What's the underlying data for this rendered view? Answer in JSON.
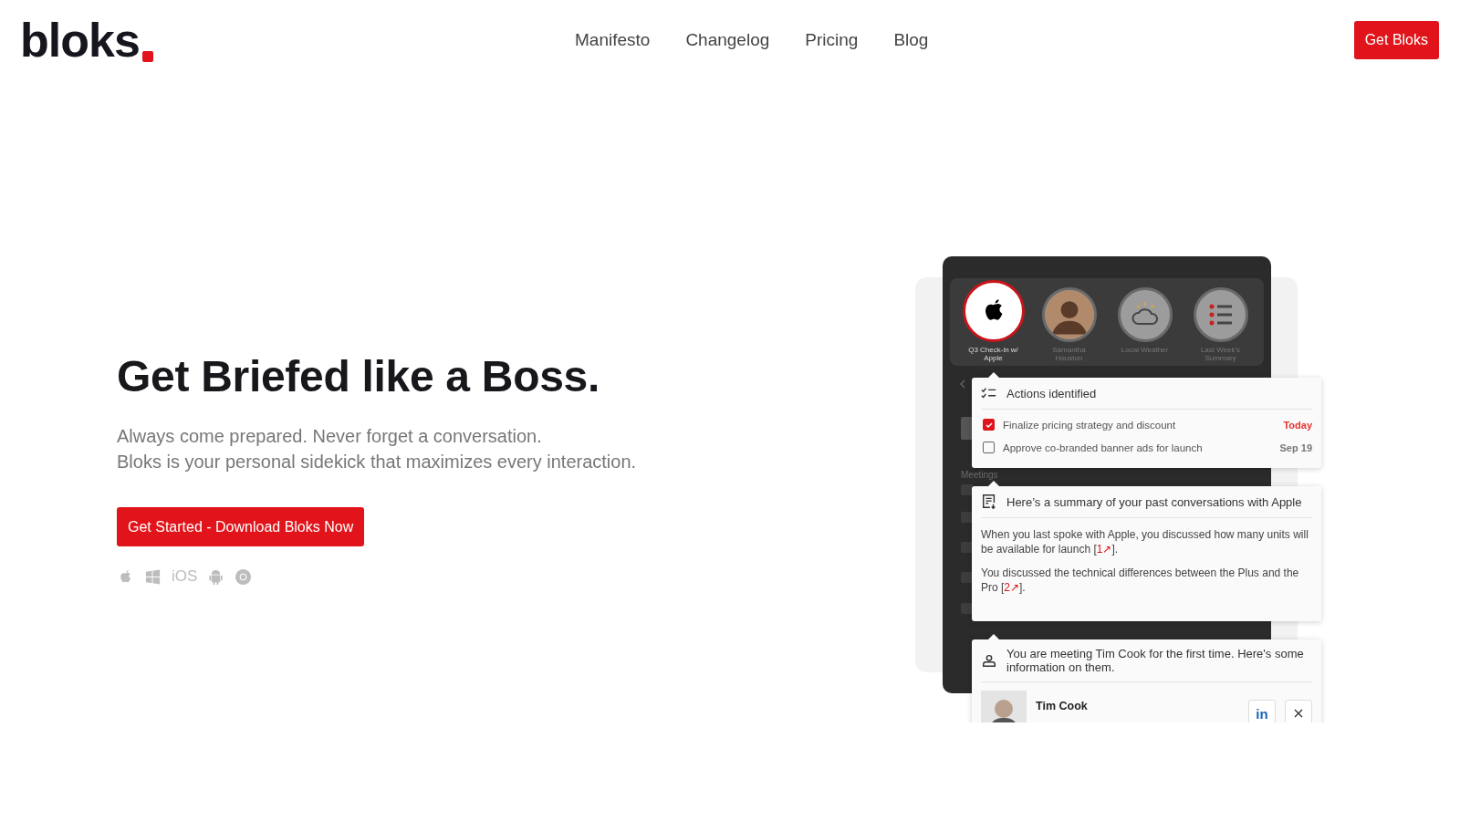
{
  "header": {
    "logo": "bloks",
    "nav": [
      {
        "label": "Manifesto"
      },
      {
        "label": "Changelog"
      },
      {
        "label": "Pricing"
      },
      {
        "label": "Blog"
      }
    ],
    "cta": "Get Bloks"
  },
  "hero": {
    "title": "Get Briefed like a Boss.",
    "subtitle_lines": [
      "Always come prepared. Never forget a conversation.",
      "Bloks is your personal sidekick that maximizes every interaction."
    ],
    "cta": "Get Started - Download Bloks Now",
    "platforms": [
      {
        "kind": "apple"
      },
      {
        "kind": "windows"
      },
      {
        "kind": "text",
        "label": "iOS"
      },
      {
        "kind": "android"
      },
      {
        "kind": "chrome"
      }
    ]
  },
  "mockup": {
    "briefs": [
      {
        "kind": "apple",
        "label": "Q3 Check-in w/ Apple",
        "selected": true
      },
      {
        "kind": "person",
        "label": "Samantha Houston",
        "selected": false
      },
      {
        "kind": "weather",
        "label": "Local Weather",
        "selected": false
      },
      {
        "kind": "list",
        "label": "Last Week's Summary",
        "selected": false
      }
    ],
    "section_label": "Meetings",
    "actions": {
      "title": "Actions identified",
      "items": [
        {
          "text": "Finalize pricing strategy and discount",
          "due": "Today",
          "color": "#e5322d",
          "checked": true
        },
        {
          "text": "Approve co-branded banner ads for launch",
          "due": "Sep 19",
          "color": "#777777",
          "checked": false
        }
      ]
    },
    "summary": {
      "title": "Here’s a summary of your past conversations with Apple",
      "paragraphs": [
        {
          "before": "When you last spoke with Apple, you discussed how many units will be available for launch [",
          "cite": "1↗",
          "after": "]."
        },
        {
          "before": "You discussed the technical differences between the Plus and the Pro [",
          "cite": "2↗",
          "after": "]."
        }
      ]
    },
    "person": {
      "intro": "You are meeting Tim Cook for the first time. Here's some information on them.",
      "name": "Tim Cook",
      "links": [
        {
          "kind": "linkedin",
          "label": "in"
        },
        {
          "kind": "x"
        }
      ]
    }
  }
}
